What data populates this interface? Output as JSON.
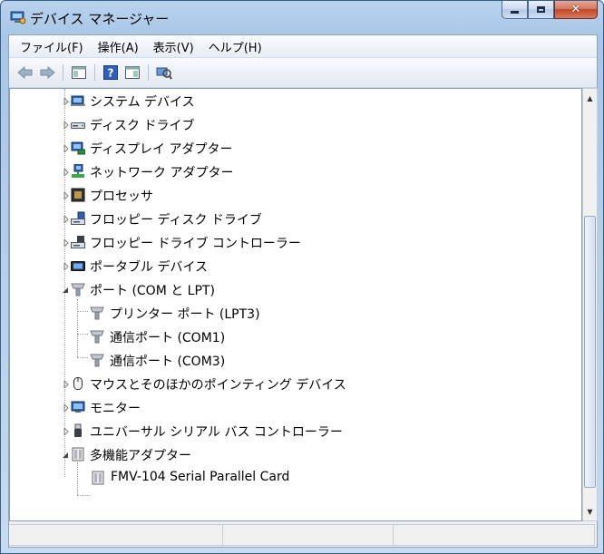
{
  "window": {
    "title": "デバイス マネージャー",
    "title_icon": "device-manager-icon",
    "colors": {
      "frame": "#b9d3ee",
      "close": "#c0492a",
      "selection": "#3399ff"
    }
  },
  "menu": [
    {
      "label": "ファイル(F)",
      "name": "menu-file"
    },
    {
      "label": "操作(A)",
      "name": "menu-action"
    },
    {
      "label": "表示(V)",
      "name": "menu-view"
    },
    {
      "label": "ヘルプ(H)",
      "name": "menu-help"
    }
  ],
  "toolbar": [
    "back-arrow-icon",
    "forward-arrow-icon",
    "show-hide-console-tree-icon",
    "help-icon",
    "properties-icon",
    "scan-hardware-icon"
  ],
  "tree": {
    "items": [
      {
        "label": "システム デバイス",
        "icon": "system-devices-icon",
        "expanded": false,
        "level": 1
      },
      {
        "label": "ディスク ドライブ",
        "icon": "disk-drive-icon",
        "expanded": false,
        "level": 1
      },
      {
        "label": "ディスプレイ アダプター",
        "icon": "display-adapter-icon",
        "expanded": false,
        "level": 1
      },
      {
        "label": "ネットワーク アダプター",
        "icon": "network-adapter-icon",
        "expanded": false,
        "level": 1
      },
      {
        "label": "プロセッサ",
        "icon": "processor-icon",
        "expanded": false,
        "level": 1
      },
      {
        "label": "フロッピー ディスク ドライブ",
        "icon": "floppy-disk-drive-icon",
        "expanded": false,
        "level": 1
      },
      {
        "label": "フロッピー ドライブ コントローラー",
        "icon": "floppy-controller-icon",
        "expanded": false,
        "level": 1
      },
      {
        "label": "ポータブル デバイス",
        "icon": "portable-device-icon",
        "expanded": false,
        "level": 1
      },
      {
        "label": "ポート (COM と LPT)",
        "icon": "port-icon",
        "expanded": true,
        "level": 1
      },
      {
        "label": "プリンター ポート (LPT3)",
        "icon": "port-icon",
        "level": 2
      },
      {
        "label": "通信ポート (COM1)",
        "icon": "port-icon",
        "level": 2
      },
      {
        "label": "通信ポート (COM3)",
        "icon": "port-icon",
        "level": 2
      },
      {
        "label": "マウスとそのほかのポインティング デバイス",
        "icon": "mouse-icon",
        "expanded": false,
        "level": 1
      },
      {
        "label": "モニター",
        "icon": "monitor-icon",
        "expanded": false,
        "level": 1
      },
      {
        "label": "ユニバーサル シリアル バス コントローラー",
        "icon": "usb-icon",
        "expanded": false,
        "level": 1
      },
      {
        "label": "多機能アダプター",
        "icon": "multifunction-adapter-icon",
        "expanded": true,
        "level": 1
      },
      {
        "label": "FMV-104 Serial Parallel Card",
        "icon": "multifunction-adapter-icon",
        "level": 2
      }
    ]
  },
  "statusbar": {
    "panes": [
      "",
      "",
      ""
    ]
  }
}
